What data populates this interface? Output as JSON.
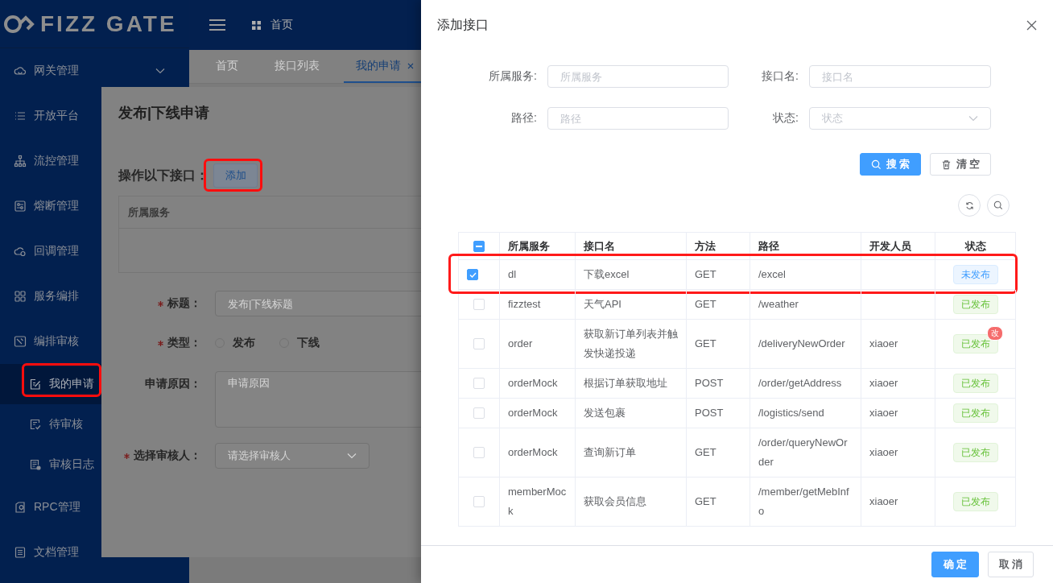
{
  "logo": {
    "text": "FIZZ GATE"
  },
  "sidebar": {
    "items": [
      {
        "label": "网关管理",
        "selected": false,
        "expanded": false
      },
      {
        "label": "开放平台",
        "selected": false
      },
      {
        "label": "流控管理",
        "selected": false
      },
      {
        "label": "熔断管理",
        "selected": false
      },
      {
        "label": "回调管理",
        "selected": false
      },
      {
        "label": "服务编排",
        "selected": false
      },
      {
        "label": "编排审核",
        "selected": false,
        "children": [
          {
            "label": "我的申请",
            "selected": true,
            "highlighted": true
          },
          {
            "label": "待审核",
            "selected": false,
            "highlighted": false
          },
          {
            "label": "审核日志",
            "selected": false,
            "highlighted": false
          }
        ]
      },
      {
        "label": "RPC管理",
        "selected": false
      },
      {
        "label": "文档管理",
        "selected": false
      }
    ]
  },
  "header": {
    "breadcrumb": "首页"
  },
  "tabs": [
    {
      "label": "首页",
      "selected": false,
      "closable": false
    },
    {
      "label": "接口列表",
      "selected": false,
      "closable": false
    },
    {
      "label": "我的申请",
      "selected": true,
      "closable": true
    }
  ],
  "apply_dialog": {
    "title": "发布|下线申请",
    "operate_label": "操作以下接口：",
    "add_button": {
      "label": "添加",
      "highlighted": true
    },
    "table": {
      "columns": [
        "所属服务"
      ]
    },
    "fields": [
      {
        "kind": "text",
        "label": "标题：",
        "required": true,
        "placeholder": "发布|下线标题"
      },
      {
        "kind": "radio",
        "label": "类型：",
        "required": true,
        "options": [
          {
            "label": "发布",
            "selected": false
          },
          {
            "label": "下线",
            "selected": false
          }
        ]
      },
      {
        "kind": "textarea",
        "label": "申请原因：",
        "required": false,
        "placeholder": "申请原因"
      },
      {
        "kind": "select",
        "label": "选择审核人：",
        "required": true,
        "placeholder": "请选择审核人"
      }
    ]
  },
  "drawer": {
    "title": "添加接口",
    "filters": [
      {
        "kind": "input",
        "label": "所属服务:",
        "placeholder": "所属服务"
      },
      {
        "kind": "input",
        "label": "接口名:",
        "placeholder": "接口名"
      },
      {
        "kind": "input",
        "label": "路径:",
        "placeholder": "路径"
      },
      {
        "kind": "select",
        "label": "状态:",
        "placeholder": "状态"
      }
    ],
    "buttons": [
      {
        "label": "搜 索",
        "kind": "primary"
      },
      {
        "label": "清 空",
        "kind": "default"
      }
    ],
    "table": {
      "select_all": {
        "indeterminate": true
      },
      "columns": [
        "所属服务",
        "接口名",
        "方法",
        "路径",
        "开发人员",
        "状态"
      ],
      "rows": [
        {
          "checked": true,
          "highlighted": true,
          "service": "dl",
          "name": "下载excel",
          "method": "GET",
          "path": "/excel",
          "status": {
            "label": "未发布",
            "kind": "unpublished"
          }
        },
        {
          "checked": false,
          "highlighted": false,
          "service": "fizztest",
          "name": "天气API",
          "method": "GET",
          "path": "/weather",
          "status": {
            "label": "已发布",
            "kind": "published"
          }
        },
        {
          "checked": false,
          "highlighted": false,
          "service": "order",
          "name": "获取新订单列表并触发快递投递",
          "method": "GET",
          "path": "/deliveryNewOrder",
          "developer": "xiaoer",
          "status": {
            "label": "已发布",
            "kind": "published"
          },
          "badge": "改"
        },
        {
          "checked": false,
          "highlighted": false,
          "service": "orderMock",
          "name": "根据订单获取地址",
          "method": "POST",
          "path": "/order/getAddress",
          "developer": "xiaoer",
          "status": {
            "label": "已发布",
            "kind": "published"
          }
        },
        {
          "checked": false,
          "highlighted": false,
          "service": "orderMock",
          "name": "发送包裹",
          "method": "POST",
          "path": "/logistics/send",
          "developer": "xiaoer",
          "status": {
            "label": "已发布",
            "kind": "published"
          }
        },
        {
          "checked": false,
          "highlighted": false,
          "service": "orderMock",
          "name": "查询新订单",
          "method": "GET",
          "path": "/order/queryNewOrder",
          "developer": "xiaoer",
          "status": {
            "label": "已发布",
            "kind": "published"
          }
        },
        {
          "checked": false,
          "highlighted": false,
          "service": "memberMock",
          "name": "获取会员信息",
          "method": "GET",
          "path": "/member/getMebInfo",
          "developer": "xiaoer",
          "status": {
            "label": "已发布",
            "kind": "published"
          }
        }
      ]
    },
    "footer_buttons": [
      {
        "label": "确 定",
        "kind": "primary"
      },
      {
        "label": "取 消",
        "kind": "default"
      }
    ]
  }
}
